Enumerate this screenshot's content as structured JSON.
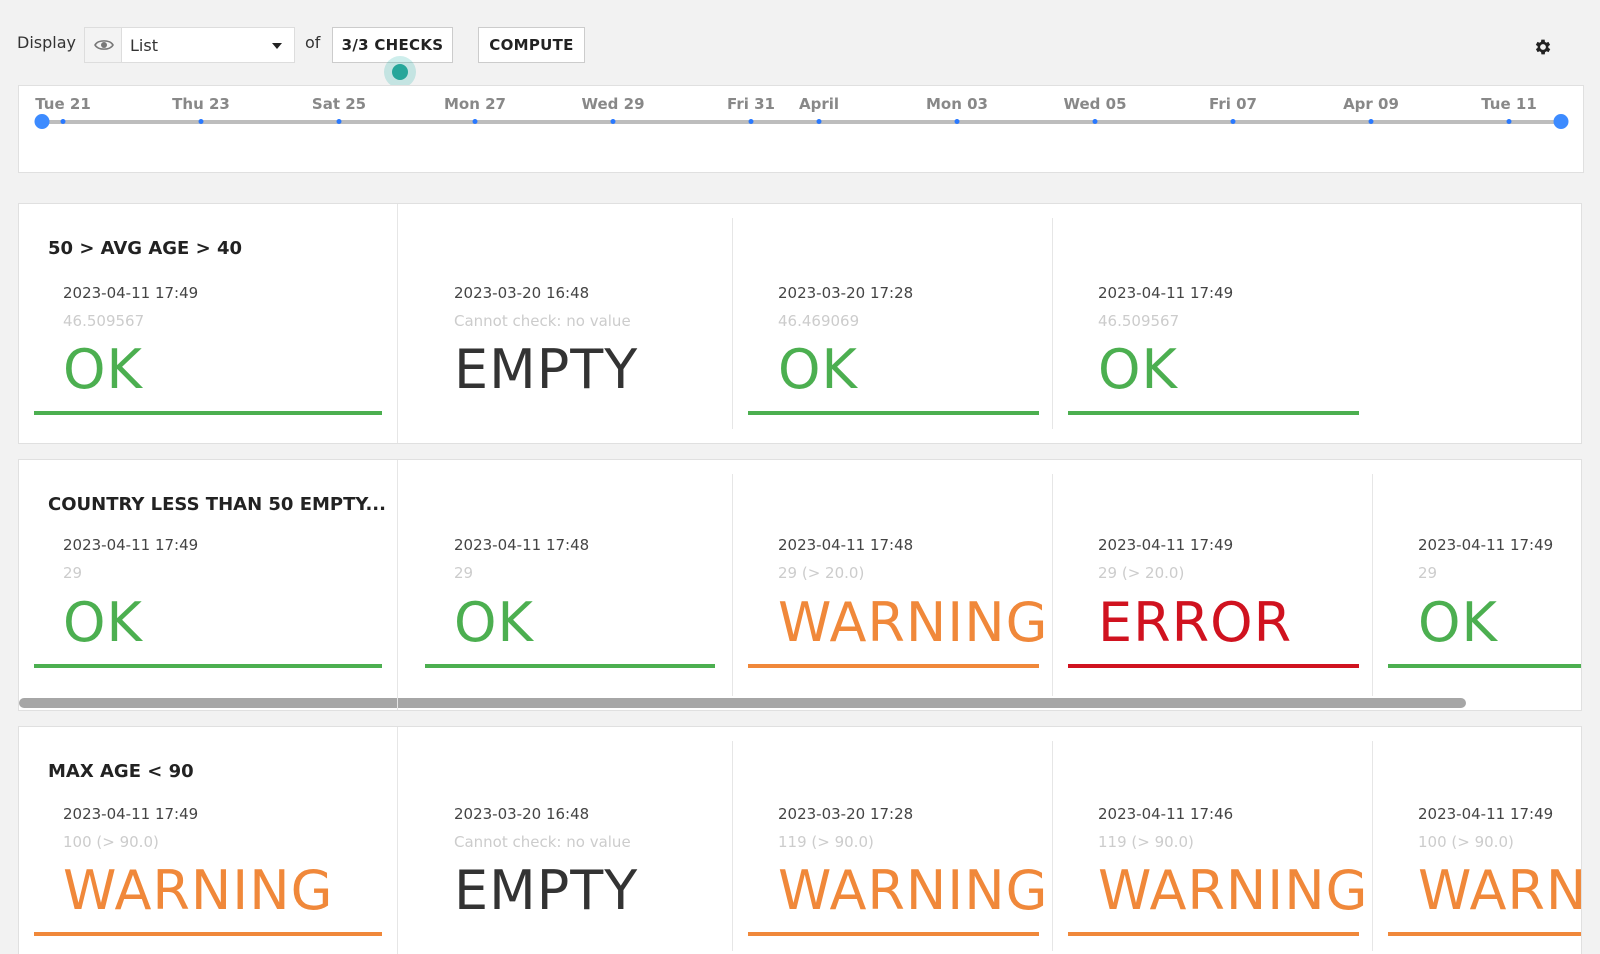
{
  "colors": {
    "ok": "#4caf50",
    "warning": "#f0883a",
    "error": "#d0121f",
    "empty": "#333333",
    "accent": "#2979ff"
  },
  "toolbar": {
    "display_label": "Display",
    "view_icon": "eye-icon",
    "select_value": "List",
    "of_label": "of",
    "checks_button": "3/3 CHECKS",
    "compute_button": "COMPUTE",
    "settings_icon": "gear-icon"
  },
  "timeline": {
    "ticks": [
      "Tue 21",
      "Thu 23",
      "Sat 25",
      "Mon 27",
      "Wed 29",
      "Fri 31",
      "April",
      "Mon 03",
      "Wed 05",
      "Fri 07",
      "Apr 09",
      "Tue 11"
    ]
  },
  "checks": [
    {
      "title": "50 > AVG AGE > 40",
      "results": [
        {
          "date": "2023-04-11 17:49",
          "value": "46.509567",
          "status": "OK"
        },
        {
          "date": "2023-03-20 16:48",
          "value": "Cannot check: no value",
          "status": "EMPTY"
        },
        {
          "date": "2023-03-20 17:28",
          "value": "46.469069",
          "status": "OK"
        },
        {
          "date": "2023-04-11 17:49",
          "value": "46.509567",
          "status": "OK"
        }
      ]
    },
    {
      "title": "COUNTRY LESS THAN 50 EMPTY...",
      "results": [
        {
          "date": "2023-04-11 17:49",
          "value": "29",
          "status": "OK"
        },
        {
          "date": "2023-04-11 17:48",
          "value": "29",
          "status": "OK"
        },
        {
          "date": "2023-04-11 17:48",
          "value": "29 (> 20.0)",
          "status": "WARNING"
        },
        {
          "date": "2023-04-11 17:49",
          "value": "29 (> 20.0)",
          "status": "ERROR"
        },
        {
          "date": "2023-04-11 17:49",
          "value": "29",
          "status": "OK"
        }
      ]
    },
    {
      "title": "MAX AGE < 90",
      "results": [
        {
          "date": "2023-04-11 17:49",
          "value": "100 (> 90.0)",
          "status": "WARNING"
        },
        {
          "date": "2023-03-20 16:48",
          "value": "Cannot check: no value",
          "status": "EMPTY"
        },
        {
          "date": "2023-03-20 17:28",
          "value": "119 (> 90.0)",
          "status": "WARNING"
        },
        {
          "date": "2023-04-11 17:46",
          "value": "119 (> 90.0)",
          "status": "WARNING"
        },
        {
          "date": "2023-04-11 17:49",
          "value": "100 (> 90.0)",
          "status": "WARNI"
        }
      ]
    }
  ]
}
